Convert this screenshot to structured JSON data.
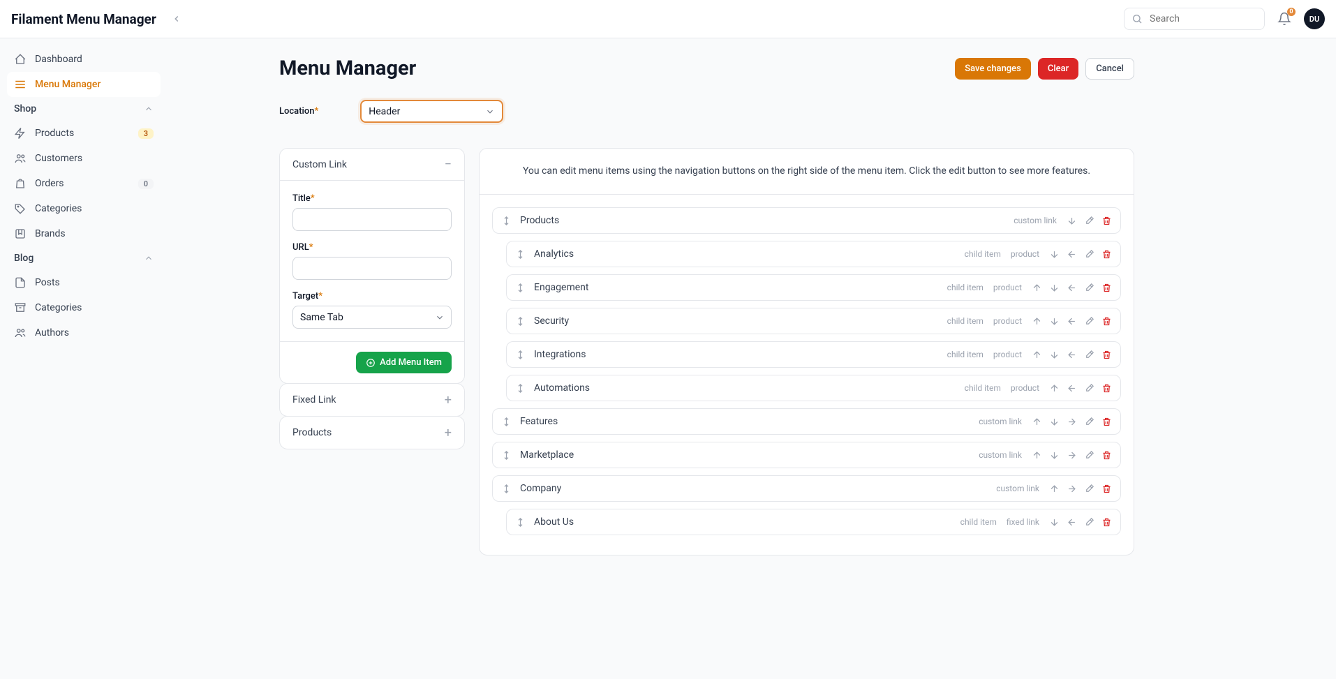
{
  "header": {
    "appTitle": "Filament Menu Manager",
    "searchPlaceholder": "Search",
    "notifCount": "0",
    "avatarInitials": "DU"
  },
  "sidebar": {
    "dashboard": "Dashboard",
    "menuManager": "Menu Manager",
    "groupShop": "Shop",
    "products": "Products",
    "productsBadge": "3",
    "customers": "Customers",
    "orders": "Orders",
    "ordersBadge": "0",
    "categories": "Categories",
    "brands": "Brands",
    "groupBlog": "Blog",
    "posts": "Posts",
    "blogCategories": "Categories",
    "authors": "Authors"
  },
  "page": {
    "title": "Menu Manager",
    "save": "Save changes",
    "clear": "Clear",
    "cancel": "Cancel",
    "locationLabel": "Location",
    "locationValue": "Header"
  },
  "customLink": {
    "heading": "Custom Link",
    "titleLabel": "Title",
    "urlLabel": "URL",
    "targetLabel": "Target",
    "targetValue": "Same Tab",
    "addButton": "Add Menu Item"
  },
  "fixedLink": {
    "heading": "Fixed Link"
  },
  "productsPanel": {
    "heading": "Products"
  },
  "itemsPanel": {
    "hint": "You can edit menu items using the navigation buttons on the right side of the menu item. Click the edit button to see more features.",
    "tags": {
      "customLink": "custom link",
      "childItem": "child item",
      "product": "product",
      "fixedLink": "fixed link"
    },
    "rows": {
      "products": "Products",
      "analytics": "Analytics",
      "engagement": "Engagement",
      "security": "Security",
      "integrations": "Integrations",
      "automations": "Automations",
      "features": "Features",
      "marketplace": "Marketplace",
      "company": "Company",
      "aboutUs": "About Us"
    }
  }
}
